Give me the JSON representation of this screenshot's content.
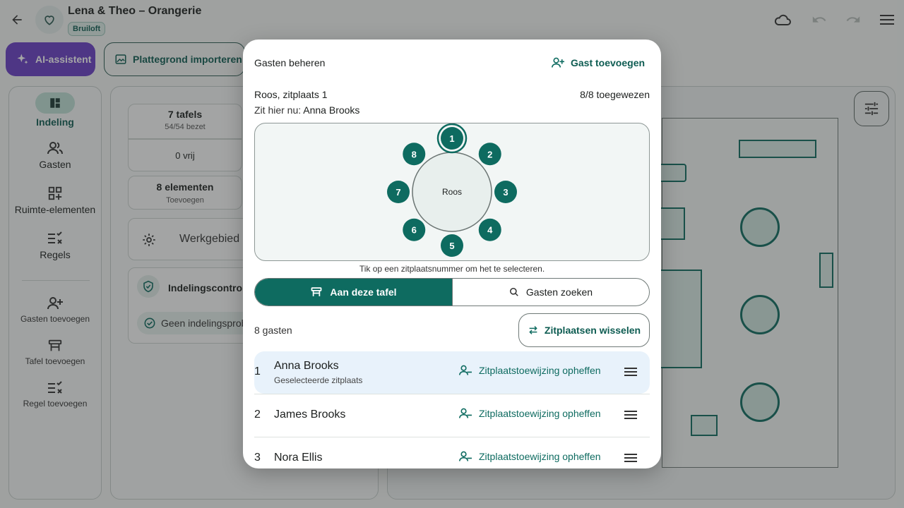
{
  "app": {
    "title": "Lena & Theo – Orangerie",
    "badge": "Bruiloft",
    "ai_button": "AI-assistent",
    "import_button": "Plattegrond importeren"
  },
  "sidebar": {
    "items": [
      {
        "label": "Indeling",
        "icon": "layout-icon",
        "active": true
      },
      {
        "label": "Gasten",
        "icon": "people-icon"
      },
      {
        "label": "Ruimte-elementen",
        "icon": "grid-add-icon"
      },
      {
        "label": "Regels",
        "icon": "rules-icon"
      }
    ],
    "actions": [
      {
        "label": "Gasten toevoegen",
        "icon": "person-add-icon"
      },
      {
        "label": "Tafel toevoegen",
        "icon": "table-icon"
      },
      {
        "label": "Regel toevoegen",
        "icon": "rules-icon"
      }
    ]
  },
  "panel": {
    "tables": {
      "title": "7 tafels",
      "sub": "54/54 bezet"
    },
    "free": {
      "title": "0 vrij"
    },
    "elements": {
      "title": "8 elementen",
      "sub": "Toevoegen"
    },
    "workspace": "Werkgebied",
    "check_title": "Indelingscontrole",
    "check_status": "Geen indelingsproblemen"
  },
  "modal": {
    "title": "Gasten beheren",
    "add_guest": "Gast toevoegen",
    "seat_line": "Roos, zitplaats 1",
    "assigned": "8/8 toegewezen",
    "now_prefix": "Zit hier nu:",
    "now_name": "Anna Brooks",
    "table_name": "Roos",
    "seats": [
      "1",
      "2",
      "3",
      "4",
      "5",
      "6",
      "7",
      "8"
    ],
    "selected_seat": "1",
    "hint": "Tik op een zitplaatsnummer om het te selecteren.",
    "tab_table": "Aan deze tafel",
    "tab_search": "Gasten zoeken",
    "guest_count": "8 gasten",
    "swap_button": "Zitplaatsen wisselen",
    "rows": [
      {
        "seat": "1",
        "name": "Anna Brooks",
        "sub": "Geselecteerde zitplaats",
        "action": "Zitplaatstoewijzing opheffen"
      },
      {
        "seat": "2",
        "name": "James Brooks",
        "action": "Zitplaatstoewijzing opheffen"
      },
      {
        "seat": "3",
        "name": "Nora Ellis",
        "action": "Zitplaatstoewijzing opheffen"
      }
    ]
  },
  "colors": {
    "primary": "#0e6b60",
    "ai": "#6a3fc6",
    "selected_row": "#e8f2fb"
  }
}
